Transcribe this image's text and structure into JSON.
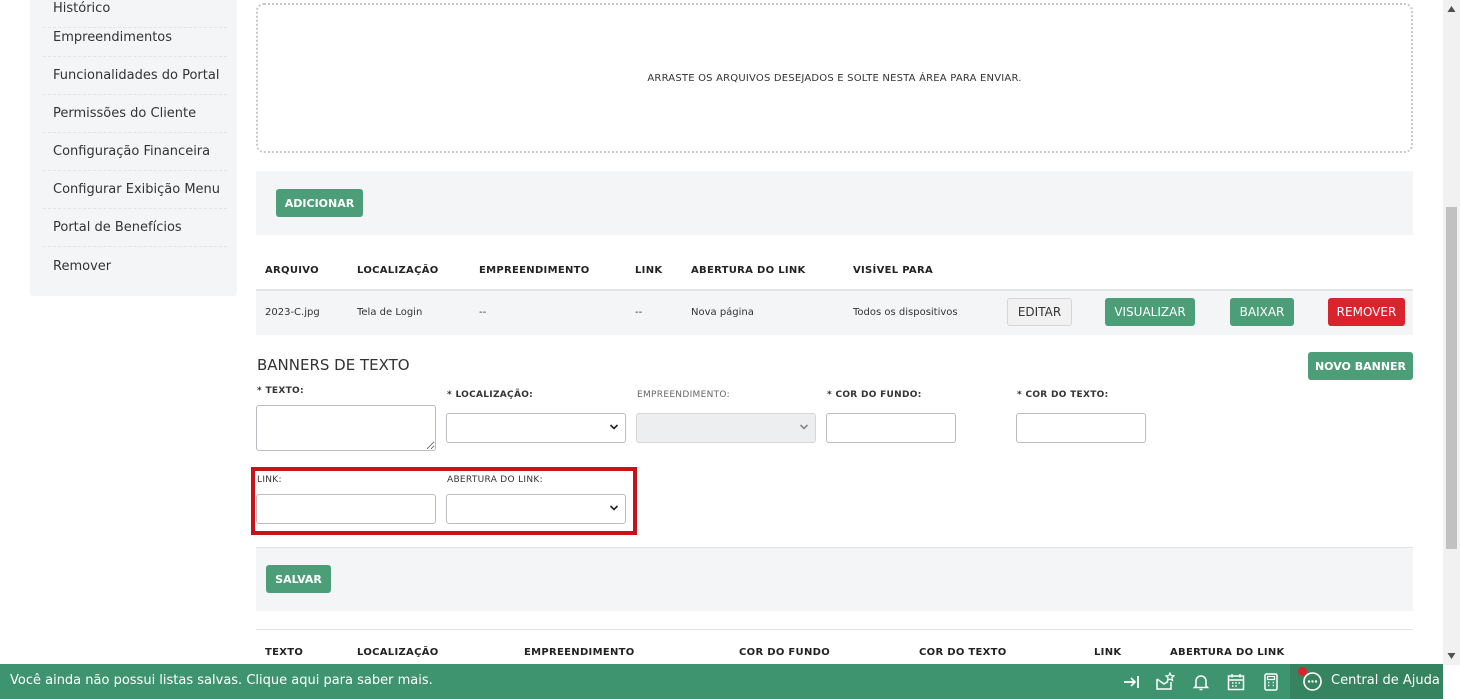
{
  "sidebar": {
    "items": [
      {
        "label": "Histórico"
      },
      {
        "label": "Empreendimentos"
      },
      {
        "label": "Funcionalidades do Portal"
      },
      {
        "label": "Permissões do Cliente"
      },
      {
        "label": "Configuração Financeira"
      },
      {
        "label": "Configurar Exibição Menu"
      },
      {
        "label": "Portal de Benefícios"
      },
      {
        "label": "Remover"
      }
    ]
  },
  "dropzone": {
    "text": "ARRASTE OS ARQUIVOS DESEJADOS E SOLTE NESTA ÁREA PARA ENVIAR."
  },
  "files": {
    "add_label": "ADICIONAR",
    "headers": [
      "ARQUIVO",
      "LOCALIZAÇÃO",
      "EMPREENDIMENTO",
      "LINK",
      "ABERTURA DO LINK",
      "VISÍVEL PARA"
    ],
    "rows": [
      {
        "arquivo": "2023-C.jpg",
        "localizacao": "Tela de Login",
        "empreendimento": "--",
        "link": "--",
        "abertura": "Nova página",
        "visivel": "Todos os dispositivos"
      }
    ],
    "actions": {
      "edit": "EDITAR",
      "view": "VISUALIZAR",
      "download": "BAIXAR",
      "remove": "REMOVER"
    }
  },
  "text_banners": {
    "title": "BANNERS DE TEXTO",
    "new_banner": "NOVO BANNER",
    "fields": {
      "texto": "* TEXTO:",
      "localizacao": "* LOCALIZAÇÃO:",
      "empreendimento": "EMPREENDIMENTO:",
      "cor_fundo": "* COR DO FUNDO:",
      "cor_texto": "* COR DO TEXTO:",
      "link": "LINK:",
      "abertura": "ABERTURA DO LINK:"
    },
    "save_label": "SALVAR",
    "headers": [
      "TEXTO",
      "LOCALIZAÇÃO",
      "EMPREENDIMENTO",
      "COR DO FUNDO",
      "COR DO TEXTO",
      "LINK",
      "ABERTURA DO LINK"
    ]
  },
  "footer": {
    "message": "Você ainda não possui listas salvas. Clique aqui para saber mais.",
    "help": "Central de Ajuda",
    "icons": [
      "collapse-right-icon",
      "mail-star-icon",
      "bell-icon",
      "calendar-icon",
      "calculator-icon",
      "chat-help-icon"
    ]
  },
  "colors": {
    "primary": "#4b9e78",
    "danger": "#d9232d",
    "footer": "#3f9470",
    "highlight": "#c8121a"
  }
}
